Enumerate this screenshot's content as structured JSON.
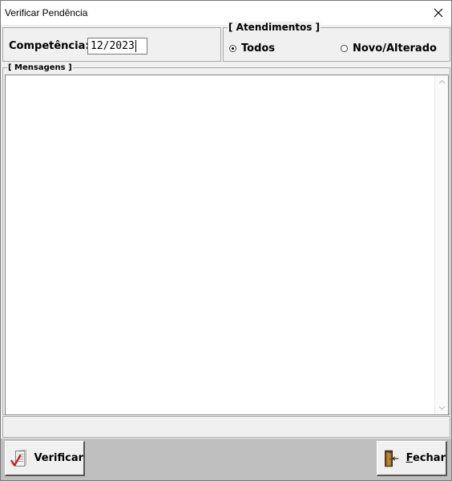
{
  "window": {
    "title": "Verificar Pendência",
    "close_icon": "close-icon"
  },
  "competencia": {
    "label": "Competência:",
    "value": "12/2023"
  },
  "atendimentos": {
    "legend": "[ Atendimentos ]",
    "options": [
      {
        "label": "Todos",
        "checked": true
      },
      {
        "label": "Novo/Alterado",
        "checked": false
      }
    ]
  },
  "mensagens": {
    "legend": "[ Mensagens ]",
    "content": ""
  },
  "buttons": {
    "verificar": {
      "label": "Verificar",
      "icon": "checklist-icon"
    },
    "fechar": {
      "label": "Fechar",
      "icon": "door-exit-icon"
    }
  }
}
